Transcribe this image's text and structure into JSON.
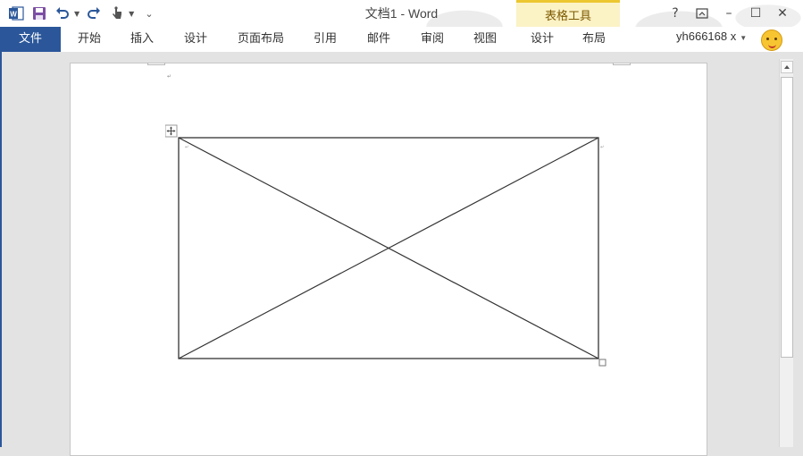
{
  "window": {
    "title": "文档1 - Word",
    "contextual_group": "表格工具",
    "help": "?",
    "controls": {
      "minimize": "–",
      "restore": "☐",
      "close": "✕"
    }
  },
  "qat": {
    "word_icon_letter": "W",
    "customize": "⌄"
  },
  "tabs": {
    "file": "文件",
    "home": "开始",
    "insert": "插入",
    "design": "设计",
    "layout": "页面布局",
    "references": "引用",
    "mailings": "邮件",
    "review": "审阅",
    "view": "视图",
    "table_design": "设计",
    "table_layout": "布局"
  },
  "user": {
    "name": "yh666168 x"
  },
  "document": {
    "paragraph_mark": "↵"
  },
  "colors": {
    "accent": "#2b579a",
    "contextual": "#fbf2c6",
    "contextual_border": "#ecc72f"
  }
}
